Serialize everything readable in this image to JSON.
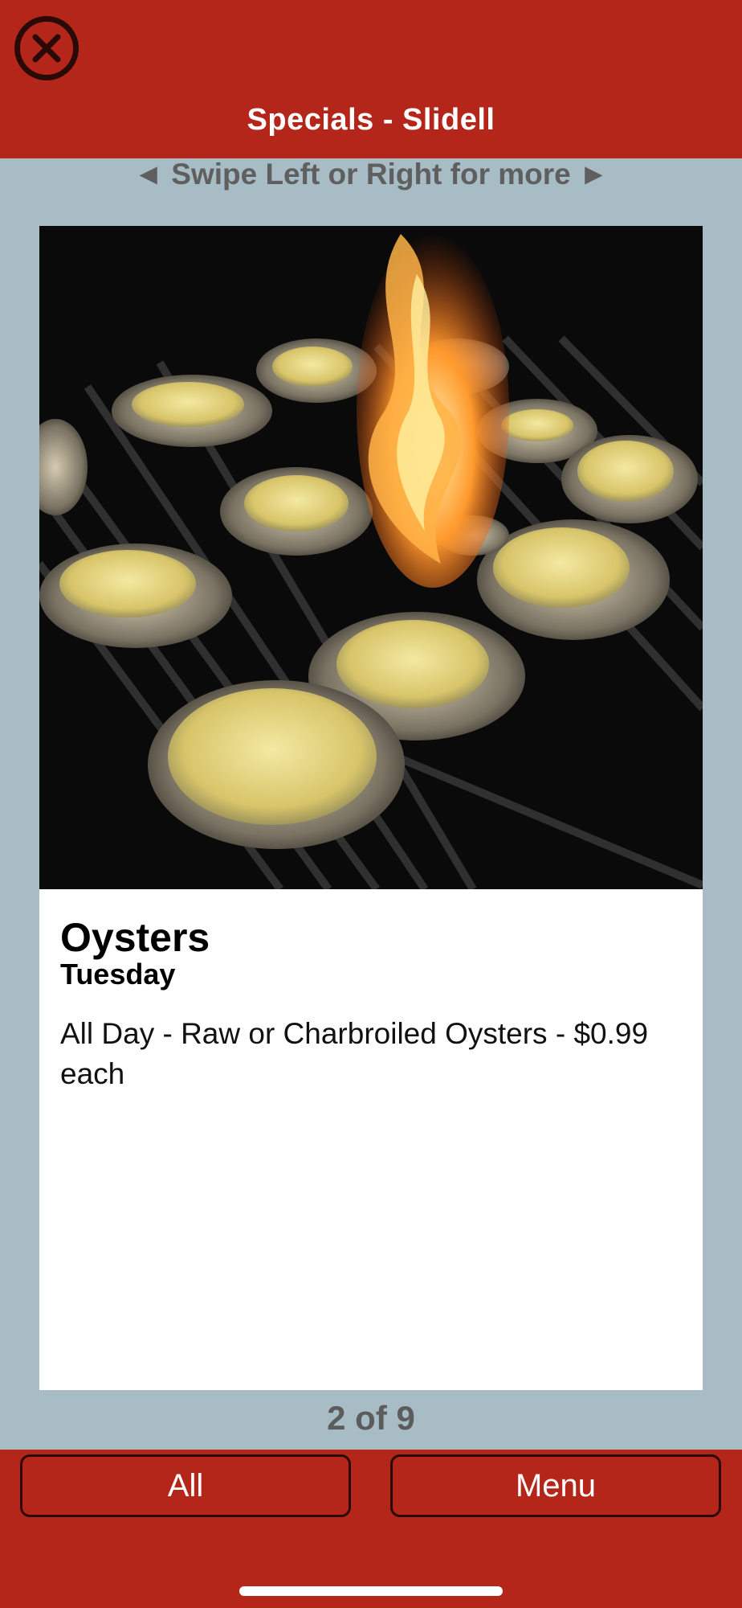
{
  "header": {
    "title": "Specials - Slidell",
    "close_icon": "close-circle-icon"
  },
  "swipe_hint": "◄ Swipe Left or Right for more ►",
  "special": {
    "image_alt": "Charbroiled oysters on a flaming grill",
    "title": "Oysters",
    "day": "Tuesday",
    "description": "All Day - Raw or Charbroiled Oysters - $0.99 each"
  },
  "pager": "2 of 9",
  "footer": {
    "all_label": "All",
    "menu_label": "Menu"
  },
  "colors": {
    "brand_red": "#b5261a",
    "background": "#a7bcc4"
  }
}
